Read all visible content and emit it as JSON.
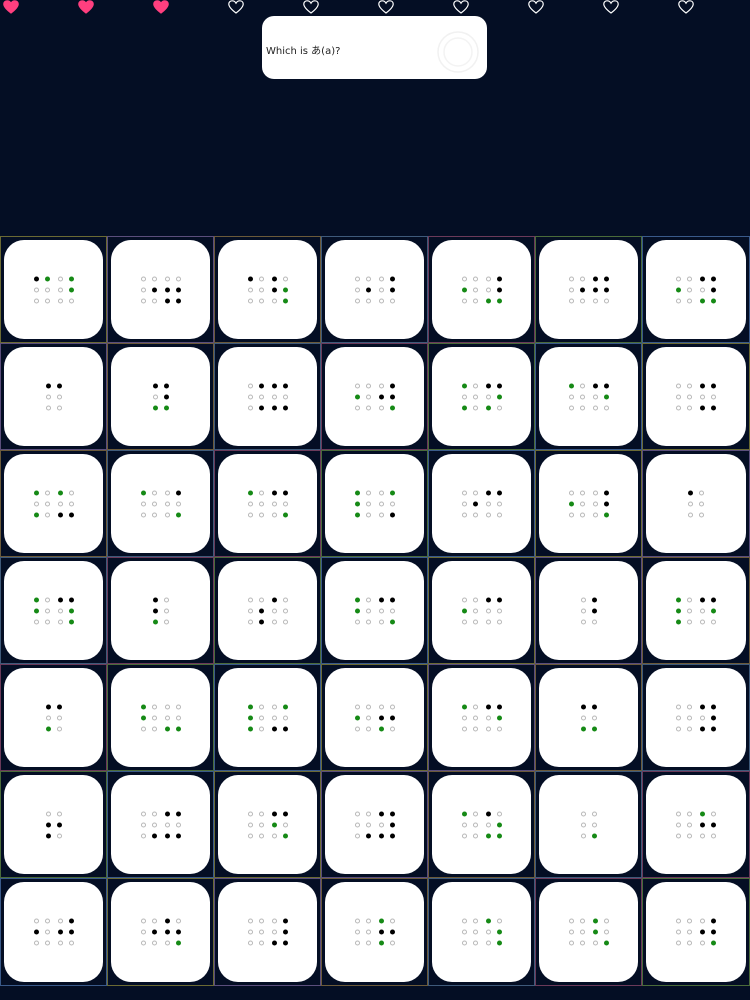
{
  "hearts": [
    "filled",
    "filled",
    "filled",
    "empty",
    "empty",
    "empty",
    "empty",
    "empty",
    "empty",
    "empty"
  ],
  "colors": {
    "background": "#040e24",
    "heart_filled": "#ff3f7f",
    "heart_outline": "#ffffff",
    "dot_raised": "#000000",
    "dot_highlight": "#168a16",
    "dot_empty": "#b8b8b8",
    "tile": "#ffffff"
  },
  "question": {
    "text": "Which is あ(a)?",
    "sound_icon": "speaker-icon"
  },
  "dot_legend": {
    "0": "empty",
    "1": "raised",
    "2": "raised-highlighted"
  },
  "tiles": [
    [
      [
        "012",
        "002"
      ],
      [
        "000",
        "102"
      ],
      [
        "000",
        "000"
      ]
    ],
    [
      [
        "000",
        "000"
      ],
      [
        "001",
        "011"
      ],
      [
        "000",
        "011"
      ]
    ],
    [
      [
        "010",
        "010"
      ],
      [
        "000",
        "012"
      ],
      [
        "000",
        "002"
      ]
    ],
    [
      [
        "000",
        "001"
      ],
      [
        "101",
        "001"
      ],
      [
        "000",
        "100"
      ]
    ],
    [
      [
        "000",
        "001"
      ],
      [
        "020",
        "001"
      ],
      [
        "000",
        "022"
      ]
    ],
    [
      [
        "000",
        "011"
      ],
      [
        "001",
        "011"
      ],
      [
        "000",
        "000"
      ]
    ],
    [
      [
        "000",
        "011"
      ],
      [
        "020",
        "001"
      ],
      [
        "000",
        "022"
      ]
    ],
    [
      [
        "011"
      ],
      [
        "000"
      ],
      [
        "000"
      ]
    ],
    [
      [
        "011"
      ],
      [
        "001"
      ],
      [
        "022"
      ]
    ],
    [
      [
        "001",
        "011"
      ],
      [
        "100",
        "000"
      ],
      [
        "101",
        "011"
      ]
    ],
    [
      [
        "000",
        "001"
      ],
      [
        "020",
        "011"
      ],
      [
        "000",
        "002"
      ]
    ],
    [
      [
        "020",
        "011"
      ],
      [
        "000",
        "002"
      ],
      [
        "020",
        "020"
      ]
    ],
    [
      [
        "020",
        "011"
      ],
      [
        "000",
        "002"
      ],
      [
        "000",
        "000"
      ]
    ],
    [
      [
        "000",
        "011"
      ],
      [
        "000",
        "000"
      ],
      [
        "000",
        "011"
      ]
    ],
    [
      [
        "020",
        "020"
      ],
      [
        "000",
        "000"
      ],
      [
        "020",
        "011"
      ]
    ],
    [
      [
        "020",
        "001"
      ],
      [
        "000",
        "000"
      ],
      [
        "000",
        "002"
      ]
    ],
    [
      [
        "020",
        "011"
      ],
      [
        "000",
        "000"
      ],
      [
        "000",
        "002"
      ]
    ],
    [
      [
        "020",
        "002"
      ],
      [
        "020",
        "000"
      ],
      [
        "020",
        "001"
      ]
    ],
    [
      [
        "000",
        "011"
      ],
      [
        "001",
        "000"
      ],
      [
        "000",
        "000"
      ]
    ],
    [
      [
        "000",
        "001"
      ],
      [
        "020",
        "001"
      ],
      [
        "000",
        "002"
      ]
    ],
    [
      [
        "010"
      ],
      [
        "000"
      ],
      [
        "000"
      ]
    ],
    [
      [
        "020",
        "011"
      ],
      [
        "020",
        "002"
      ],
      [
        "000",
        "002"
      ]
    ],
    [
      [
        "010"
      ],
      [
        "010"
      ],
      [
        "020"
      ]
    ],
    [
      [
        "000",
        "010"
      ],
      [
        "001",
        "000"
      ],
      [
        "001",
        "000"
      ]
    ],
    [
      [
        "020",
        "011"
      ],
      [
        "020",
        "000"
      ],
      [
        "000",
        "002"
      ]
    ],
    [
      [
        "000",
        "011"
      ],
      [
        "020",
        "000"
      ],
      [
        "000",
        "000"
      ]
    ],
    [
      [
        "001"
      ],
      [
        "001"
      ],
      [
        "000"
      ]
    ],
    [
      [
        "020",
        "011"
      ],
      [
        "020",
        "002"
      ],
      [
        "020",
        "000"
      ]
    ],
    [
      [
        "011"
      ],
      [
        "000"
      ],
      [
        "020"
      ]
    ],
    [
      [
        "020",
        "000"
      ],
      [
        "020",
        "000"
      ],
      [
        "000",
        "022"
      ]
    ],
    [
      [
        "020",
        "002"
      ],
      [
        "020",
        "000"
      ],
      [
        "020",
        "011"
      ]
    ],
    [
      [
        "000",
        "000"
      ],
      [
        "020",
        "011"
      ],
      [
        "000",
        "020"
      ]
    ],
    [
      [
        "020",
        "011"
      ],
      [
        "000",
        "002"
      ],
      [
        "000",
        "000"
      ]
    ],
    [
      [
        "011"
      ],
      [
        "000"
      ],
      [
        "022"
      ]
    ],
    [
      [
        "000",
        "011"
      ],
      [
        "000",
        "001"
      ],
      [
        "000",
        "011"
      ]
    ],
    [
      [
        "000"
      ],
      [
        "011"
      ],
      [
        "010"
      ]
    ],
    [
      [
        "000",
        "011"
      ],
      [
        "000",
        "000"
      ],
      [
        "001",
        "011"
      ]
    ],
    [
      [
        "000",
        "011"
      ],
      [
        "000",
        "020"
      ],
      [
        "000",
        "002"
      ]
    ],
    [
      [
        "000",
        "011"
      ],
      [
        "000",
        "001"
      ],
      [
        "001",
        "011"
      ]
    ],
    [
      [
        "020",
        "010"
      ],
      [
        "000",
        "002"
      ],
      [
        "000",
        "022"
      ]
    ],
    [
      [
        "000"
      ],
      [
        "000"
      ],
      [
        "002"
      ]
    ],
    [
      [
        "000",
        "020"
      ],
      [
        "000",
        "011"
      ],
      [
        "000",
        "000"
      ]
    ],
    [
      [
        "000",
        "001"
      ],
      [
        "010",
        "011"
      ],
      [
        "000",
        "000"
      ]
    ],
    [
      [
        "000",
        "010"
      ],
      [
        "001",
        "011"
      ],
      [
        "000",
        "002"
      ]
    ],
    [
      [
        "000",
        "001"
      ],
      [
        "000",
        "001"
      ],
      [
        "000",
        "011"
      ]
    ],
    [
      [
        "000",
        "020"
      ],
      [
        "000",
        "011"
      ],
      [
        "000",
        "020"
      ]
    ],
    [
      [
        "000",
        "020"
      ],
      [
        "000",
        "002"
      ],
      [
        "000",
        "002"
      ]
    ],
    [
      [
        "000",
        "020"
      ],
      [
        "000",
        "020"
      ],
      [
        "000",
        "002"
      ]
    ],
    [
      [
        "000",
        "001"
      ],
      [
        "000",
        "011"
      ],
      [
        "000",
        "002"
      ]
    ]
  ]
}
